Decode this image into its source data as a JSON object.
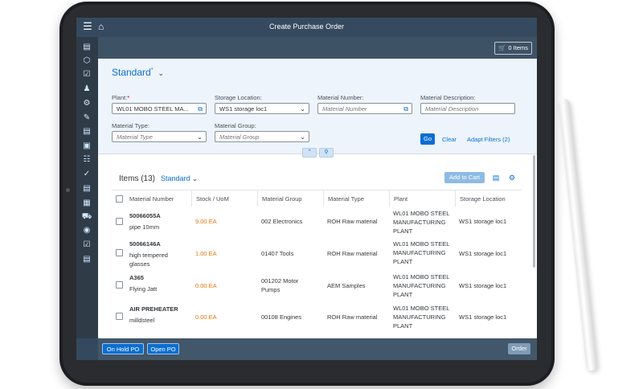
{
  "shell": {
    "title": "Create Purchase Order"
  },
  "toolbar": {
    "cart_label": "0 Items"
  },
  "filter": {
    "variant": "Standard",
    "variant_marker": "*",
    "plant": {
      "label": "Plant:",
      "required": "*",
      "value": "WL01 MOBO STEEL MA..."
    },
    "storage_location": {
      "label": "Storage Location:",
      "value": "WS1 storage loc1"
    },
    "material_number": {
      "label": "Material Number:",
      "placeholder": "Material Number"
    },
    "material_description": {
      "label": "Material Description:",
      "placeholder": "Material Description"
    },
    "material_type": {
      "label": "Material Type:",
      "placeholder": "Material Type"
    },
    "material_group": {
      "label": "Material Group:",
      "placeholder": "Material Group"
    },
    "go_label": "Go",
    "clear_label": "Clear",
    "adapt_label": "Adapt Filters (2)"
  },
  "table": {
    "title": "Items (13)",
    "variant": "Standard",
    "add_to_cart_label": "Add to Cart",
    "columns": [
      "Material Number",
      "Stock / UoM",
      "Material Group",
      "Material Type",
      "Plant",
      "Storage Location"
    ],
    "rows": [
      {
        "id": "50066055A",
        "desc": "pipe 10mm",
        "stock": "9.00 EA",
        "group": "002 Electronics",
        "type": "ROH Raw material",
        "plant": "WL01 MOBO STEEL MANUFACTURING PLANT",
        "sloc": "WS1 storage loc1"
      },
      {
        "id": "50066146A",
        "desc": "high tempered glasses",
        "stock": "1.00 EA",
        "group": "01407 Tools",
        "type": "ROH Raw material",
        "plant": "WL01 MOBO STEEL MANUFACTURING PLANT",
        "sloc": "WS1 storage loc1"
      },
      {
        "id": "A365",
        "desc": "Flying Jatt",
        "stock": "0.00 EA",
        "group": "001202 Motor Pumps",
        "type": "AEM Samples",
        "plant": "WL01 MOBO STEEL MANUFACTURING PLANT",
        "sloc": "WS1 storage loc1"
      },
      {
        "id": "AIR PREHEATER",
        "desc": "milldsteel",
        "stock": "0.00 EA",
        "group": "00108 Engines",
        "type": "ROH Raw material",
        "plant": "WL01 MOBO STEEL MANUFACTURING PLANT",
        "sloc": "WS1 storage loc1"
      }
    ]
  },
  "footer": {
    "on_hold_label": "On Hold PO",
    "open_label": "Open PO",
    "order_label": "Order"
  }
}
